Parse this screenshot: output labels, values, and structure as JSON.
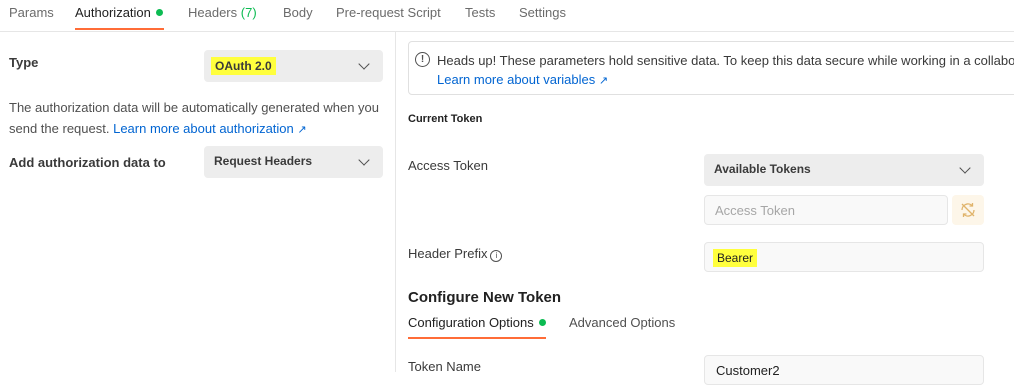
{
  "tabs": [
    {
      "label": "Params"
    },
    {
      "label": "Authorization",
      "active": true
    },
    {
      "label": "Headers",
      "count": "(7)"
    },
    {
      "label": "Body"
    },
    {
      "label": "Pre-request Script"
    },
    {
      "label": "Tests"
    },
    {
      "label": "Settings"
    }
  ],
  "auth": {
    "type_label": "Type",
    "type_value": "OAuth 2.0",
    "description": "The authorization data will be automatically generated when you send the request.",
    "learn_more": "Learn more about authorization",
    "add_to_label": "Add authorization data to",
    "add_to_value": "Request Headers"
  },
  "notice": {
    "text": "Heads up! These parameters hold sensitive data. To keep this data secure while working in a collabora",
    "link": "Learn more about variables"
  },
  "current_token": {
    "title": "Current Token",
    "access_token_label": "Access Token",
    "available_tokens": "Available Tokens",
    "access_token_placeholder": "Access Token",
    "header_prefix_label": "Header Prefix",
    "header_prefix_value": "Bearer"
  },
  "configure": {
    "title": "Configure New Token",
    "tabs": [
      "Configuration Options",
      "Advanced Options"
    ],
    "token_name_label": "Token Name",
    "token_name_value": "Customer2"
  },
  "colors": {
    "accent": "#ff6c37",
    "success": "#0cbb52",
    "link": "#0265d2",
    "highlight": "#ffff3d"
  }
}
